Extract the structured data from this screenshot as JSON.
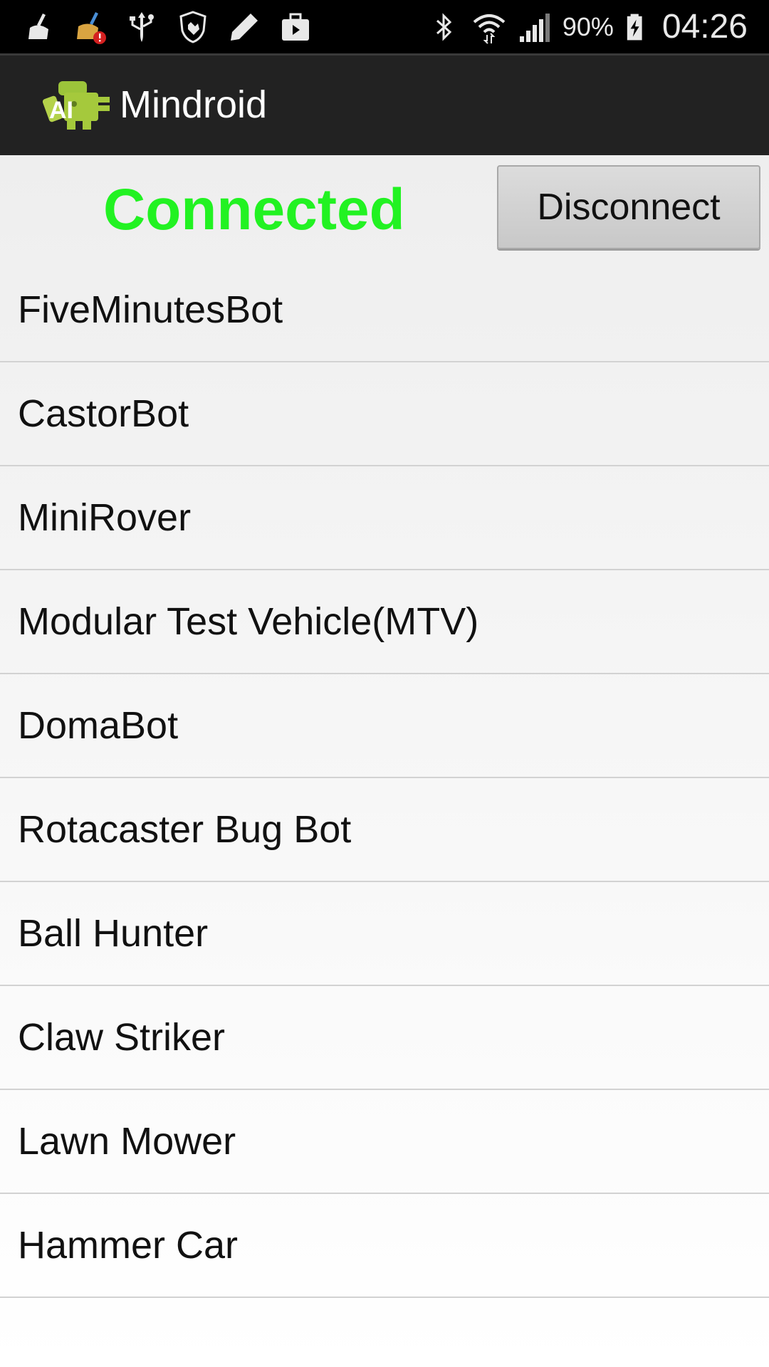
{
  "status_bar": {
    "left_icons": [
      "cleaner-icon",
      "cleaner-alert-icon",
      "usb-icon",
      "shield-hand-icon",
      "pencil-icon",
      "briefcase-icon"
    ],
    "right_icons": [
      "bluetooth-icon",
      "wifi-icon",
      "signal-icon"
    ],
    "battery_percent": "90%",
    "battery_icon": "battery-charging-icon",
    "time": "04:26"
  },
  "action_bar": {
    "logo_icon": "mindroid-logo-icon",
    "title": "Mindroid"
  },
  "connection": {
    "status": "Connected",
    "status_color": "#22f222",
    "button_label": "Disconnect"
  },
  "robots": [
    {
      "label": "FiveMinutesBot"
    },
    {
      "label": "CastorBot"
    },
    {
      "label": "MiniRover"
    },
    {
      "label": "Modular Test Vehicle(MTV)"
    },
    {
      "label": "DomaBot"
    },
    {
      "label": "Rotacaster Bug Bot"
    },
    {
      "label": "Ball Hunter"
    },
    {
      "label": "Claw Striker"
    },
    {
      "label": "Lawn Mower"
    },
    {
      "label": "Hammer Car"
    }
  ]
}
